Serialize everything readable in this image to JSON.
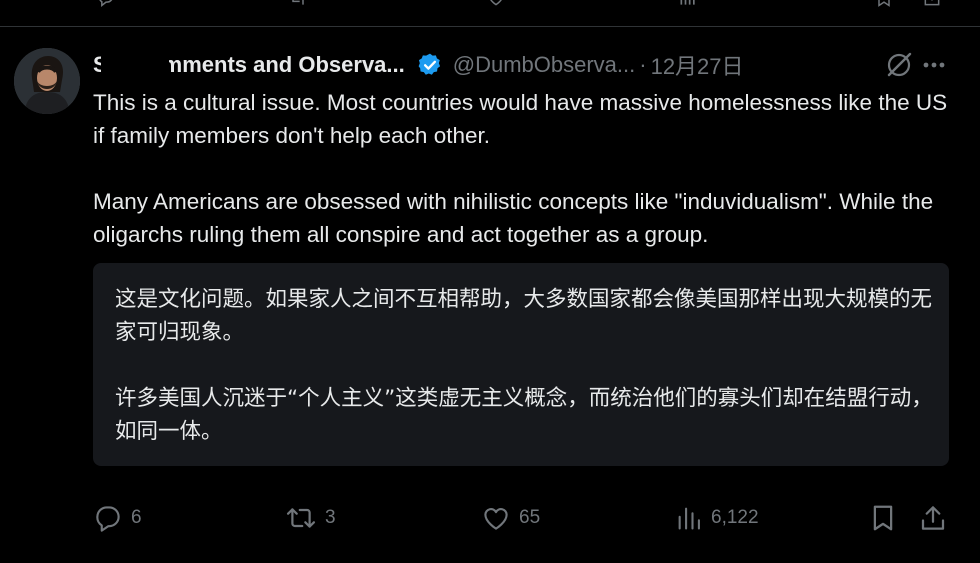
{
  "tweet": {
    "display_name": "S     d Comments and Observa...",
    "verified": true,
    "handle": "@DumbObserva...",
    "separator": "·",
    "date": "12月27日",
    "body": [
      "This is a cultural issue. Most countries would have massive homelessness like the US if family members don't help each other.",
      "Many Americans are obsessed with nihilistic concepts like \"induvidualism\". While the oligarchs ruling them all conspire and act together as a group."
    ],
    "translation": [
      "这是文化问题。如果家人之间不互相帮助，大多数国家都会像美国那样出现大规模的无家可归现象。",
      "许多美国人沉迷于“个人主义”这类虚无主义概念，而统治他们的寡头们却在结盟行动，如同一体。"
    ]
  },
  "actions": {
    "replies": "6",
    "reposts": "3",
    "likes": "65",
    "views": "6,122"
  },
  "colors": {
    "background": "#000000",
    "text": "#e7e9ea",
    "muted": "#71767b",
    "verified": "#1d9bf0",
    "translation_bg": "#16181c",
    "divider": "#2f3336"
  },
  "icons": {
    "verified": "verified-badge-icon",
    "grok": "grok-icon",
    "more": "more-icon",
    "reply": "reply-icon",
    "repost": "repost-icon",
    "like": "like-icon",
    "views": "views-icon",
    "bookmark": "bookmark-icon",
    "share": "share-icon"
  }
}
